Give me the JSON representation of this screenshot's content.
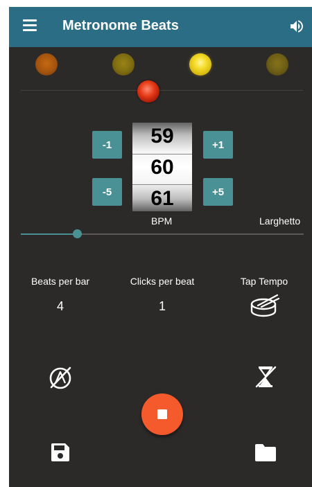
{
  "app": {
    "title": "Metronome Beats"
  },
  "toolbar": {
    "menu_icon": "menu-icon",
    "sound_icon": "speaker-icon"
  },
  "beat_lights": [
    {
      "color": "#b4560f",
      "state": "dim"
    },
    {
      "color": "#8c7a16",
      "state": "dim"
    },
    {
      "color": "#f2d726",
      "state": "active"
    },
    {
      "color": "#7a6a18",
      "state": "dim"
    }
  ],
  "accent_light": {
    "color": "#e53a17"
  },
  "tempo": {
    "minus_one": "-1",
    "plus_one": "+1",
    "minus_five": "-5",
    "plus_five": "+5",
    "prev": "59",
    "current": "60",
    "next": "61",
    "unit": "BPM",
    "tempo_name": "Larghetto",
    "slider_fraction": 0.2
  },
  "settings": {
    "beats_per_bar_label": "Beats per bar",
    "beats_per_bar_value": "4",
    "clicks_per_beat_label": "Clicks per beat",
    "clicks_per_beat_value": "1",
    "tap_tempo_label": "Tap Tempo",
    "tap_icon": "drum-icon"
  },
  "controls": {
    "no_subdivision_icon": "no-metronome-icon",
    "timer_off_icon": "timer-off-icon",
    "stop_icon": "stop-icon",
    "save_icon": "save-icon",
    "open_icon": "folder-icon"
  },
  "colors": {
    "toolbar": "#2b6d85",
    "accent": "#4a9195",
    "stop": "#f45a2b",
    "background": "#2c2a28"
  }
}
